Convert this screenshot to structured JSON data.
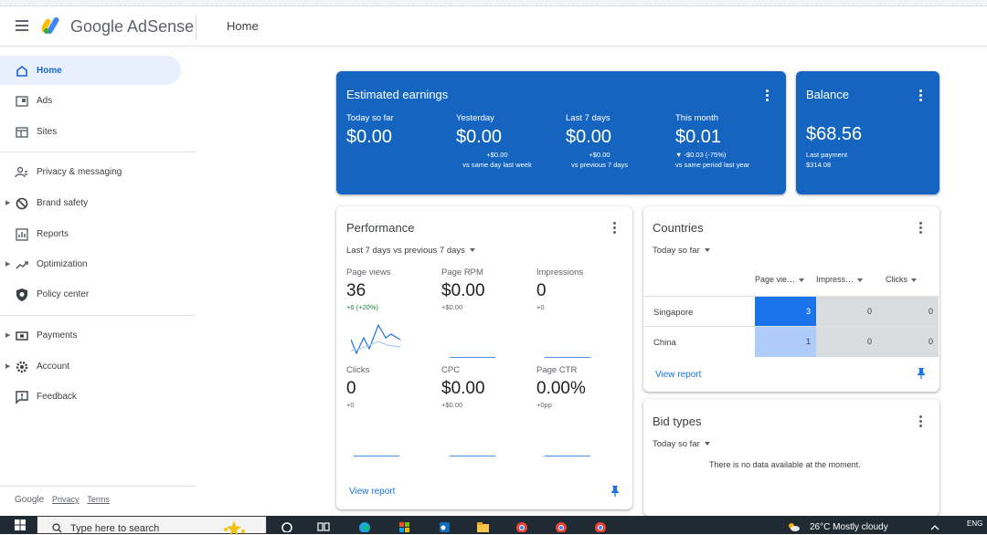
{
  "header": {
    "brand": "Google AdSense",
    "breadcrumb": "Home"
  },
  "sidebar": {
    "items": [
      {
        "label": "Home",
        "icon": "home-icon",
        "active": true
      },
      {
        "label": "Ads",
        "icon": "ads-icon"
      },
      {
        "label": "Sites",
        "icon": "sites-icon"
      },
      {
        "label": "Privacy & messaging",
        "icon": "privacy-icon"
      },
      {
        "label": "Brand safety",
        "icon": "block-icon"
      },
      {
        "label": "Reports",
        "icon": "reports-icon"
      },
      {
        "label": "Optimization",
        "icon": "trending-icon"
      },
      {
        "label": "Policy center",
        "icon": "shield-icon"
      },
      {
        "label": "Payments",
        "icon": "payments-icon"
      },
      {
        "label": "Account",
        "icon": "gear-icon"
      },
      {
        "label": "Feedback",
        "icon": "feedback-icon"
      }
    ],
    "footer": {
      "google": "Google",
      "privacy": "Privacy",
      "terms": "Terms"
    }
  },
  "earnings": {
    "title": "Estimated earnings",
    "cols": [
      {
        "label": "Today so far",
        "value": "$0.00",
        "change": "",
        "compare": ""
      },
      {
        "label": "Yesterday",
        "value": "$0.00",
        "change": "+$0.00",
        "compare": "vs same day last week"
      },
      {
        "label": "Last 7 days",
        "value": "$0.00",
        "change": "+$0.00",
        "compare": "vs previous 7 days"
      },
      {
        "label": "This month",
        "value": "$0.01",
        "change": "▼ -$0.03 (-75%)",
        "compare": "vs same period last year"
      }
    ]
  },
  "balance": {
    "title": "Balance",
    "value": "$68.56",
    "last_payment_label": "Last payment",
    "last_payment_value": "$314.08"
  },
  "performance": {
    "title": "Performance",
    "range": "Last 7 days vs previous 7 days",
    "metrics": [
      {
        "label": "Page views",
        "value": "36",
        "change": "+6 (+20%)"
      },
      {
        "label": "Page RPM",
        "value": "$0.00",
        "change": "+$0.00"
      },
      {
        "label": "Impressions",
        "value": "0",
        "change": "+0"
      },
      {
        "label": "Clicks",
        "value": "0",
        "change": "+0"
      },
      {
        "label": "CPC",
        "value": "$0.00",
        "change": "+$0.00"
      },
      {
        "label": "Page CTR",
        "value": "0.00%",
        "change": "+0pp"
      }
    ],
    "view_report": "View report"
  },
  "countries": {
    "title": "Countries",
    "range": "Today so far",
    "columns": [
      "Page vie…",
      "Impress…",
      "Clicks"
    ],
    "rows": [
      {
        "name": "Singapore",
        "values": [
          "3",
          "0",
          "0"
        ]
      },
      {
        "name": "China",
        "values": [
          "1",
          "0",
          "0"
        ]
      }
    ],
    "view_report": "View report"
  },
  "bid_types": {
    "title": "Bid types",
    "range": "Today so far",
    "empty": "There is no data available at the moment."
  },
  "taskbar": {
    "search_placeholder": "Type here to search",
    "weather": "26°C  Mostly cloudy",
    "lang": "ENG"
  },
  "colors": {
    "accent": "#1565c0",
    "link": "#1a73e8",
    "active_bg": "#e8f0fe",
    "heat_high": "#1a73e8",
    "heat_low": "#aecbfa",
    "heat_zero": "#dadce0"
  }
}
